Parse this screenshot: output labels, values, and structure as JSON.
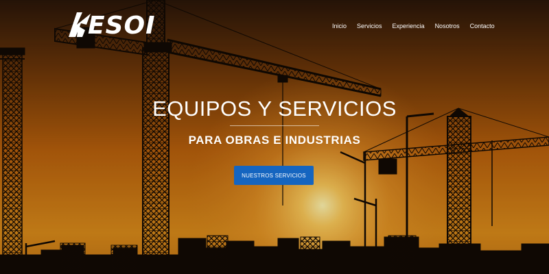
{
  "brand": {
    "logo_text": "ESOI",
    "logo_icon": "esoi-logo-mark"
  },
  "nav": {
    "items": [
      {
        "label": "Inicio"
      },
      {
        "label": "Servicios"
      },
      {
        "label": "Experiencia"
      },
      {
        "label": "Nosotros"
      },
      {
        "label": "Contacto"
      }
    ]
  },
  "hero": {
    "title": "EQUIPOS Y SERVICIOS",
    "subtitle": "PARA OBRAS E INDUSTRIAS",
    "cta_label": "NUESTROS SERVICIOS",
    "background": "construction-cranes-at-sunset"
  },
  "colors": {
    "sky_top": "#2a1608",
    "sky_mid": "#b8600c",
    "sun_glow": "#ffd060",
    "silhouette": "#120a04",
    "button": "#1565c0",
    "text": "#ffffff"
  }
}
